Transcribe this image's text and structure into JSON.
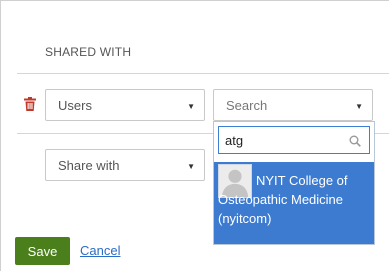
{
  "section": {
    "title": "SHARED WITH"
  },
  "row1": {
    "type_select": {
      "value": "Users"
    },
    "target_select": {
      "placeholder": "Search"
    }
  },
  "row2": {
    "permission_select": {
      "value": "Share with"
    }
  },
  "dropdown": {
    "query": "atg",
    "results": [
      {
        "label": "NYIT College of Osteopathic Medicine (nyitcom)"
      }
    ]
  },
  "actions": {
    "save_label": "Save",
    "cancel_label": "Cancel"
  },
  "colors": {
    "save": "#4a7f1c",
    "highlight": "#3d7bd0",
    "trash": "#c0392b",
    "link": "#2b6cc4"
  },
  "icons": {
    "delete": "trash-icon",
    "search": "search-icon",
    "caret": "caret-down-icon",
    "avatar": "user-avatar-icon"
  }
}
